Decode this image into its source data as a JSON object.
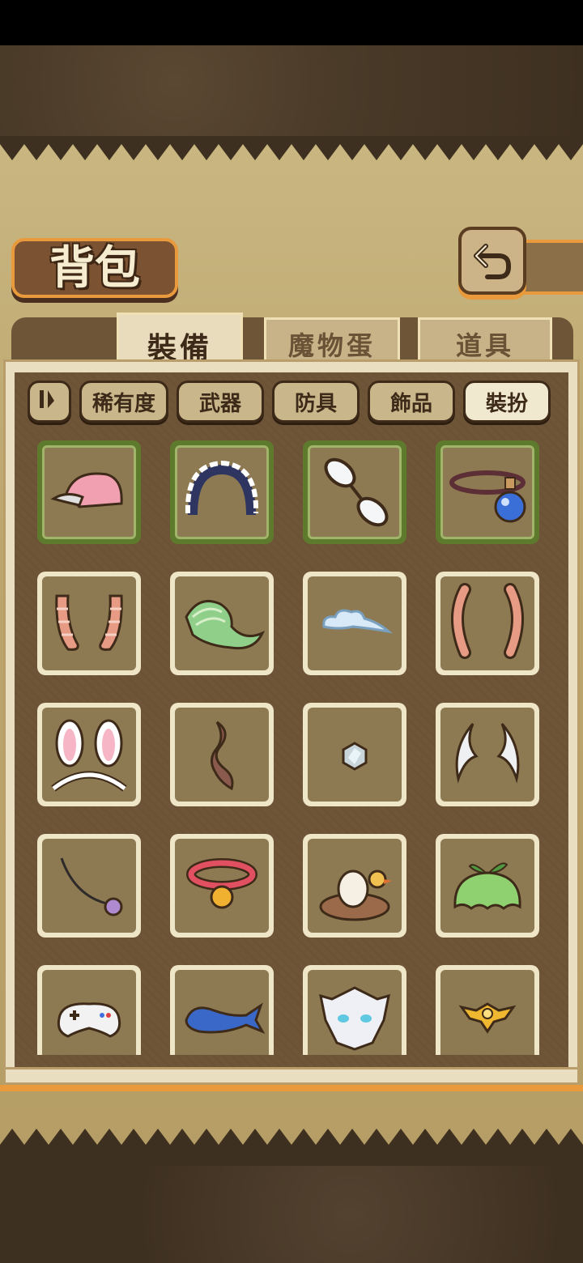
{
  "header": {
    "title": "背包",
    "back_icon": "back-arrow-icon"
  },
  "tabs": [
    {
      "label": "裝備",
      "active": true
    },
    {
      "label": "魔物蛋",
      "active": false
    },
    {
      "label": "道具",
      "active": false
    }
  ],
  "filters": {
    "sort_icon": "sort-pause-icon",
    "items": [
      {
        "label": "稀有度",
        "active": false
      },
      {
        "label": "武器",
        "active": false
      },
      {
        "label": "防具",
        "active": false
      },
      {
        "label": "飾品",
        "active": false
      },
      {
        "label": "裝扮",
        "active": true
      }
    ]
  },
  "inventory": [
    {
      "icon": "pink-cap-icon",
      "rare": true
    },
    {
      "icon": "maid-headband-icon",
      "rare": true
    },
    {
      "icon": "glasses-icon",
      "rare": true
    },
    {
      "icon": "potion-necklace-icon",
      "rare": true
    },
    {
      "icon": "striped-horns-icon",
      "rare": false
    },
    {
      "icon": "green-scarf-icon",
      "rare": false
    },
    {
      "icon": "cloud-icon",
      "rare": false
    },
    {
      "icon": "curved-horns-icon",
      "rare": false
    },
    {
      "icon": "bunny-ears-icon",
      "rare": false
    },
    {
      "icon": "wavy-tail-icon",
      "rare": false
    },
    {
      "icon": "crystal-icon",
      "rare": false
    },
    {
      "icon": "white-horns-icon",
      "rare": false
    },
    {
      "icon": "tail-whip-icon",
      "rare": false
    },
    {
      "icon": "bell-collar-icon",
      "rare": false
    },
    {
      "icon": "nest-duck-icon",
      "rare": false
    },
    {
      "icon": "slime-hat-icon",
      "rare": false
    },
    {
      "icon": "game-controller-icon",
      "rare": false
    },
    {
      "icon": "fish-tail-icon",
      "rare": false
    },
    {
      "icon": "dragon-mask-icon",
      "rare": false
    },
    {
      "icon": "gold-emblem-icon",
      "rare": false
    }
  ],
  "colors": {
    "accent": "#e99a3c",
    "rare_border": "#5e7a2c",
    "panel": "#6e5537",
    "parchment": "#bda66e"
  }
}
